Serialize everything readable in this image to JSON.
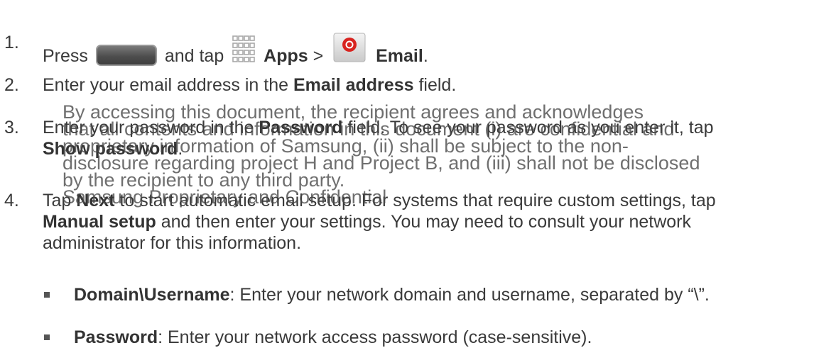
{
  "steps": [
    {
      "number": "1.",
      "press": "Press",
      "and_tap": "and tap",
      "apps": "Apps",
      "sep": ">",
      "email": "Email",
      "end": ".",
      "icons": [
        "home-key-icon",
        "apps-grid-icon",
        "email-app-icon"
      ]
    },
    {
      "number": "2.",
      "pre": "Enter your email address in the",
      "bold": "Email address",
      "post": "field."
    },
    {
      "number": "3.",
      "pre": "Enter your password in the",
      "bold": "Password",
      "post": "field. To see your password as you enter it, tap",
      "bold2": "Show password",
      "end": "."
    },
    {
      "number": "4.",
      "pre": "Tap",
      "bold": "Next",
      "post": "to start automatic email setup. For systems that require custom settings, tap",
      "bold2": "Manual setup",
      "post2": "and then enter your settings. You may need to consult your network",
      "line3": "administrator for this information."
    }
  ],
  "bullets": [
    {
      "bold": "Domain\\Username",
      "text": ": Enter your network domain and username, separated by “\\”."
    },
    {
      "bold": "Password",
      "text": ": Enter your network access password (case-sensitive)."
    }
  ],
  "watermark": {
    "lines": [
      "By accessing this document, the recipient agrees and acknowledges",
      "that all contents and information in this document (i) are confidential and",
      "proprietary information of Samsung, (ii) shall be subject to the non-",
      "disclosure regarding project H and Project B, and (iii) shall not be disclosed",
      "by the recipient to any third party.",
      "Samsung Proprietary and Confidential"
    ]
  },
  "colors": {
    "text": "#3a3a3a",
    "email_icon_red": "#d8231f"
  }
}
